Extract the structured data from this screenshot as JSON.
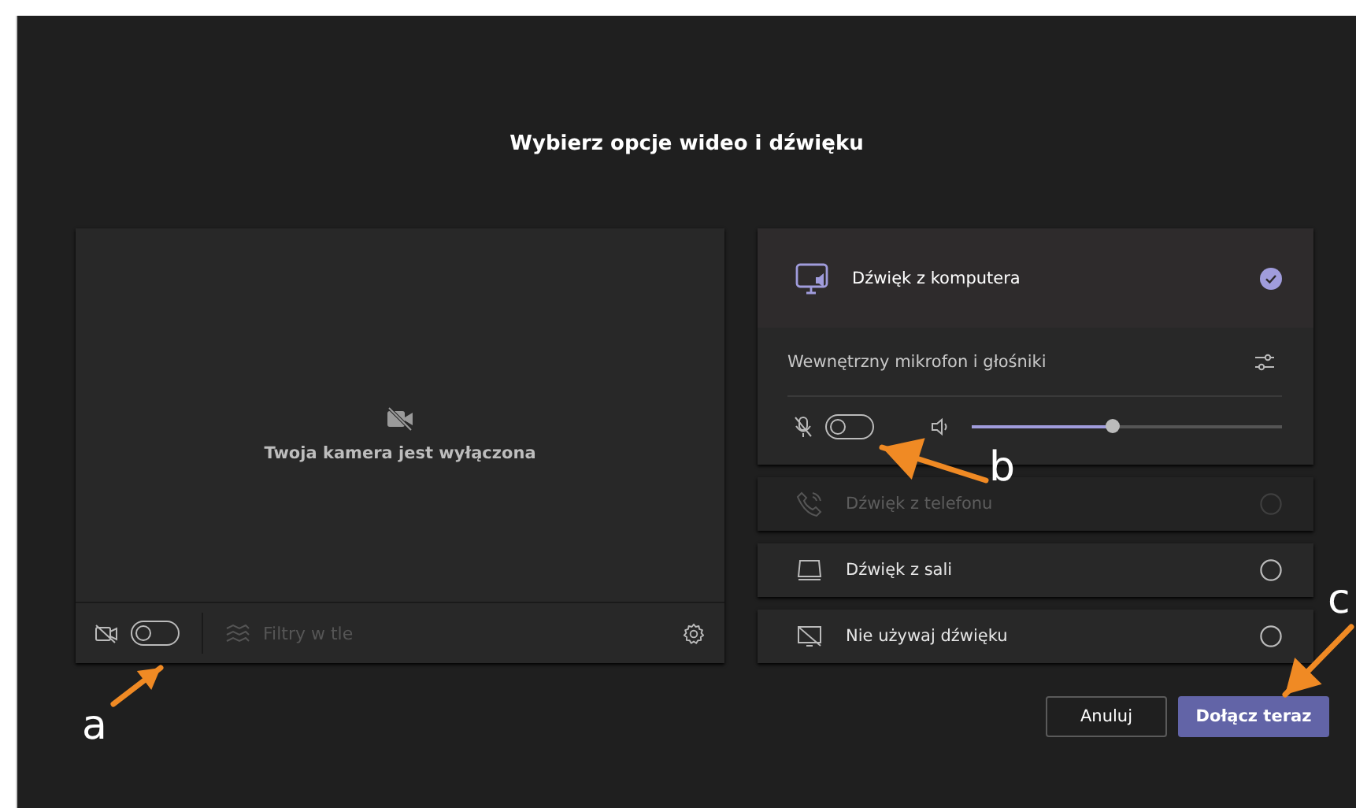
{
  "title": "Wybierz opcje wideo i dźwięku",
  "camera": {
    "message": "Twoja kamera jest wyłączona",
    "toggle_on": false,
    "filter_label": "Filtry w tle",
    "filter_disabled": true
  },
  "audio_options": [
    {
      "kind": "computer",
      "label": "Dźwięk z komputera",
      "selected": true,
      "disabled": false
    },
    {
      "kind": "phone",
      "label": "Dźwięk z telefonu",
      "selected": false,
      "disabled": true
    },
    {
      "kind": "room",
      "label": "Dźwięk z sali",
      "selected": false,
      "disabled": false
    },
    {
      "kind": "none",
      "label": "Nie używaj dźwięku",
      "selected": false,
      "disabled": false
    }
  ],
  "device": {
    "label": "Wewnętrzny mikrofon i głośniki",
    "mic_on": false,
    "level": 0.45
  },
  "buttons": [
    {
      "label": "Anuluj",
      "kind": "secondary"
    },
    {
      "label": "Dołącz teraz",
      "kind": "primary"
    }
  ],
  "annotations": [
    {
      "label": "a"
    },
    {
      "label": "b"
    },
    {
      "label": "c"
    }
  ]
}
